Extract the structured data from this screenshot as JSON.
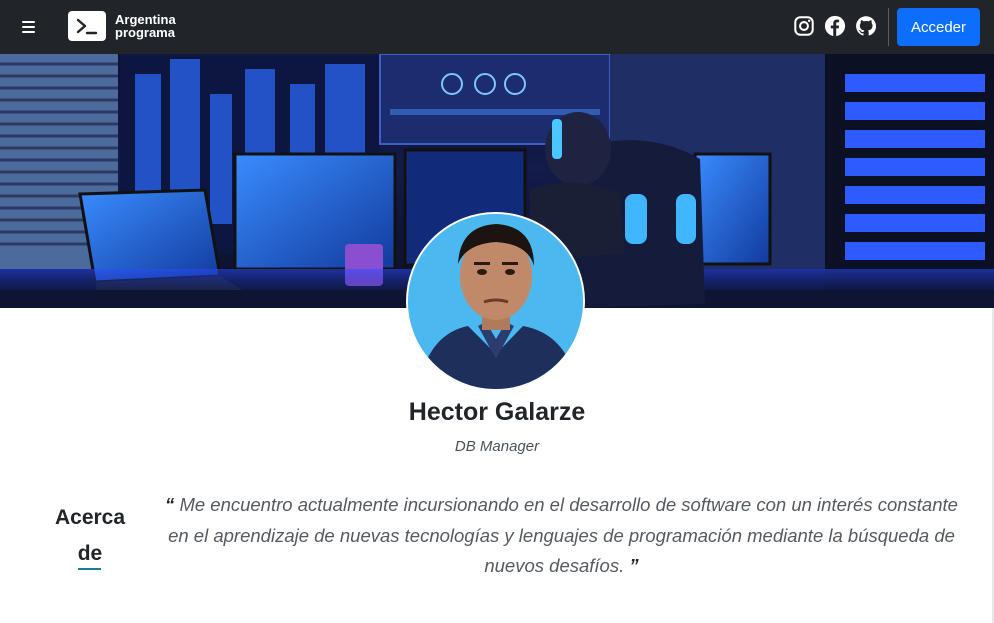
{
  "navbar": {
    "brand_line1": "Argentina",
    "brand_line2": "programa",
    "login_label": "Acceder",
    "social_icons": [
      "instagram-icon",
      "facebook-icon",
      "github-icon"
    ],
    "menu_icon": "hamburger-icon"
  },
  "profile": {
    "name": "Hector Galarze",
    "role": "DB Manager"
  },
  "about": {
    "title_line1": "Acerca",
    "title_line2": "de",
    "open_quote": "“",
    "text": "Me encuentro actualmente incursionando en el desarrollo de software con un interés constante en el aprendizaje de nuevas tecnologías y lenguajes de programación mediante la búsqueda de nuevos desafíos.",
    "close_quote": "”"
  },
  "colors": {
    "navbar_bg": "#212529",
    "accent_button": "#0d6efd",
    "avatar_bg": "#4cb8f0",
    "underline": "#1a7f8e"
  }
}
